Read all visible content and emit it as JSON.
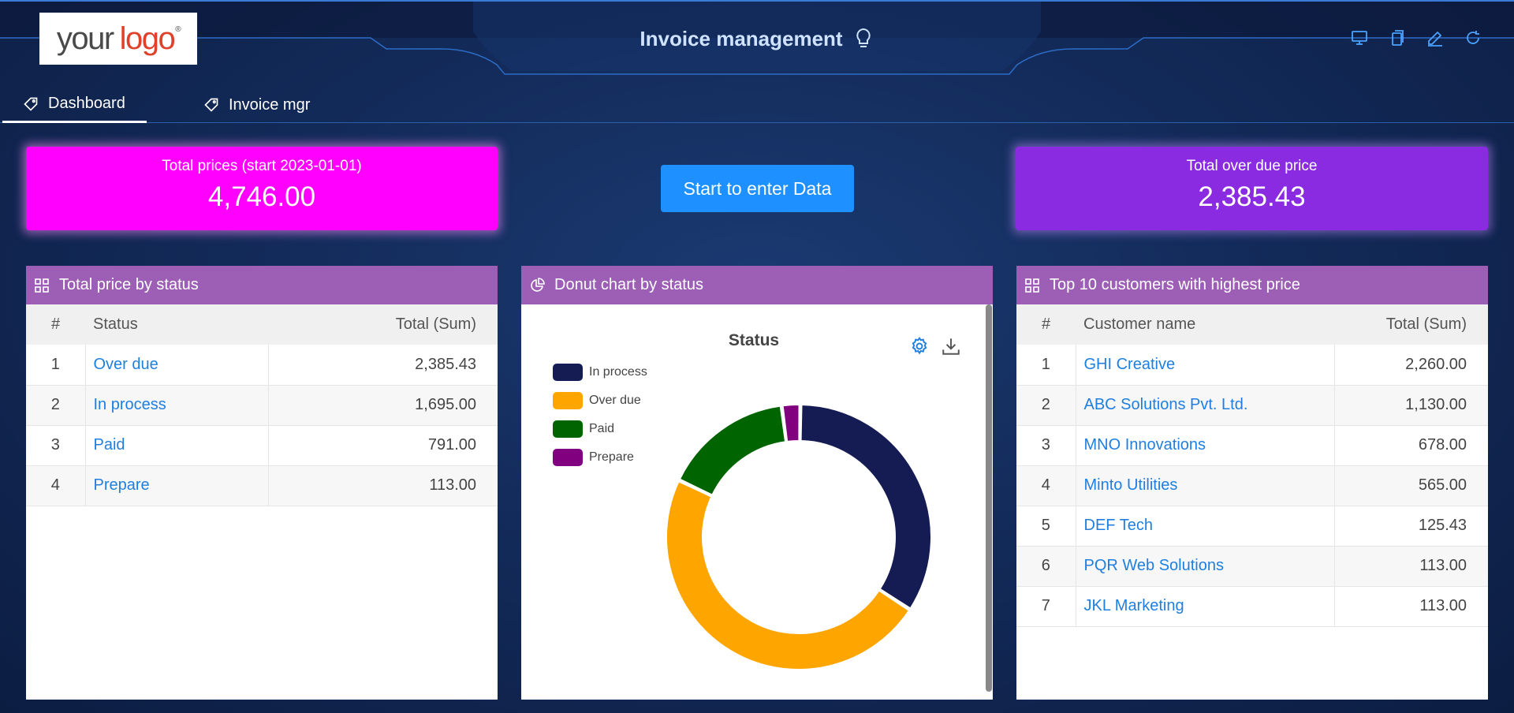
{
  "header": {
    "logo": {
      "word1": "your",
      "word2": "logo",
      "mark": "®"
    },
    "title": "Invoice management",
    "title_icon": "lightbulb-icon",
    "icons": [
      "monitor-icon",
      "copy-icon",
      "edit-icon",
      "refresh-icon"
    ]
  },
  "tabs": [
    {
      "label": "Dashboard",
      "icon": "tag-icon",
      "active": true
    },
    {
      "label": "Invoice mgr",
      "icon": "tag-icon",
      "active": false
    }
  ],
  "kpis": {
    "total": {
      "label": "Total prices (start 2023-01-01)",
      "value": "4,746.00",
      "color": "#ff00ff"
    },
    "overdue": {
      "label": "Total over due price",
      "value": "2,385.43",
      "color": "#8a2be2"
    }
  },
  "start_button": {
    "label": "Start to enter Data",
    "color": "#1e90ff"
  },
  "panel_status": {
    "title": "Total price by status",
    "columns": {
      "num": "#",
      "name": "Status",
      "total": "Total (Sum)"
    },
    "rows": [
      {
        "num": "1",
        "name": "Over due",
        "total": "2,385.43"
      },
      {
        "num": "2",
        "name": "In process",
        "total": "1,695.00"
      },
      {
        "num": "3",
        "name": "Paid",
        "total": "791.00"
      },
      {
        "num": "4",
        "name": "Prepare",
        "total": "113.00"
      }
    ]
  },
  "panel_donut": {
    "title": "Donut chart by status"
  },
  "chart_data": {
    "type": "pie",
    "title": "Status",
    "legend_position": "top-left",
    "donut": true,
    "categories": [
      "In process",
      "Over due",
      "Paid",
      "Prepare"
    ],
    "values": [
      1695.0,
      2385.43,
      791.0,
      113.0
    ],
    "colors": [
      "#151c54",
      "#ffa500",
      "#006400",
      "#800080"
    ]
  },
  "panel_customers": {
    "title": "Top 10 customers with highest price",
    "columns": {
      "num": "#",
      "name": "Customer name",
      "total": "Total (Sum)"
    },
    "rows": [
      {
        "num": "1",
        "name": "GHI Creative",
        "total": "2,260.00"
      },
      {
        "num": "2",
        "name": "ABC Solutions Pvt. Ltd.",
        "total": "1,130.00"
      },
      {
        "num": "3",
        "name": "MNO Innovations",
        "total": "678.00"
      },
      {
        "num": "4",
        "name": "Minto Utilities",
        "total": "565.00"
      },
      {
        "num": "5",
        "name": "DEF Tech",
        "total": "125.43"
      },
      {
        "num": "6",
        "name": "PQR Web Solutions",
        "total": "113.00"
      },
      {
        "num": "7",
        "name": "JKL Marketing",
        "total": "113.00"
      }
    ]
  },
  "colors": {
    "panel_header": "#9c5fb5",
    "link": "#1f7fe0",
    "title_text": "#cfe3ff"
  }
}
